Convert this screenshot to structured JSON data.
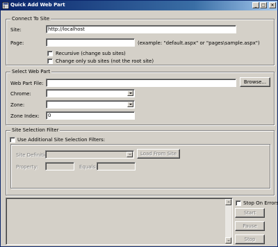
{
  "window": {
    "title": "Quick Add Web Part",
    "minimize": "_",
    "maximize": "□",
    "close": "×"
  },
  "connect": {
    "group_title": "Connect To Site",
    "site_label": "Site:",
    "site_value": "http://localhost",
    "page_label": "Page:",
    "page_value": "",
    "page_example": "(example: \"default.aspx\" or \"pages\\sample.aspx\")",
    "recursive_label": "Recursive (change sub sites)",
    "recursive_checked": false,
    "subsites_only_label": "Change only sub sites (not the root site)",
    "subsites_only_checked": false
  },
  "webpart": {
    "group_title": "Select Web Part",
    "file_label": "Web Part File:",
    "file_value": "",
    "browse_label": "Browse...",
    "chrome_label": "Chrome:",
    "chrome_value": "",
    "zone_label": "Zone:",
    "zone_value": "",
    "zone_index_label": "Zone Index:",
    "zone_index_value": "0"
  },
  "filter": {
    "group_title": "Site Selection Filter",
    "use_filters_label": "Use Additional Site Selection Filters:",
    "use_filters_checked": false,
    "site_def_label": "Site Definition:",
    "site_def_value": "",
    "load_button": "Load From Site",
    "property_label": "Property:",
    "property_value": "",
    "equals_label": "Equals:",
    "equals_value": ""
  },
  "actions": {
    "stop_on_errors_label": "Stop On Errors",
    "stop_on_errors_checked": false,
    "start_label": "Start",
    "pause_label": "Pause",
    "stop_label": "Stop"
  },
  "log": {
    "text": ""
  }
}
